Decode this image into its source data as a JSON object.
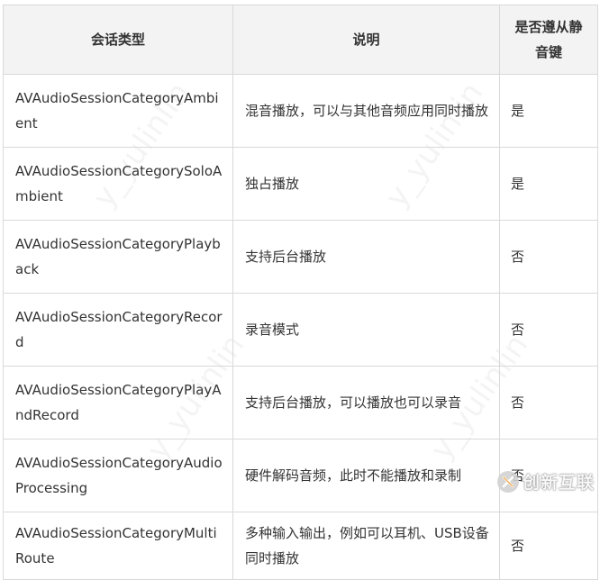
{
  "table": {
    "headers": [
      "会话类型",
      "说明",
      "是否遵从静音键"
    ],
    "rows": [
      {
        "category": "AVAudioSessionCategoryAmbient",
        "description": "混音播放，可以与其他音频应用同时播放",
        "obeys_mute": "是"
      },
      {
        "category": "AVAudioSessionCategorySoloAmbient",
        "description": "独占播放",
        "obeys_mute": "是"
      },
      {
        "category": "AVAudioSessionCategoryPlayback",
        "description": "支持后台播放",
        "obeys_mute": "否"
      },
      {
        "category": "AVAudioSessionCategoryRecord",
        "description": "录音模式",
        "obeys_mute": "否"
      },
      {
        "category": "AVAudioSessionCategoryPlayAndRecord",
        "description": "支持后台播放，可以播放也可以录音",
        "obeys_mute": "否"
      },
      {
        "category": "AVAudioSessionCategoryAudioProcessing",
        "description": "硬件解码音频，此时不能播放和录制",
        "obeys_mute": "否"
      },
      {
        "category": "AVAudioSessionCategoryMultiRoute",
        "description": "多种输入输出，例如可以耳机、USB设备同时播放",
        "obeys_mute": "否"
      }
    ]
  },
  "watermark": {
    "text": "y_yulinlin"
  },
  "logo": {
    "text": "创新互联",
    "icon": "x-logo-icon"
  },
  "colors": {
    "header_bg": "#f3f3f3",
    "border": "#d9d9d9",
    "text": "#333333"
  }
}
